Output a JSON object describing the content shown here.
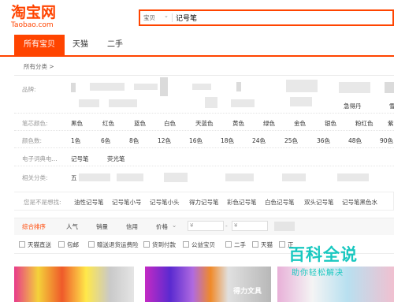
{
  "header": {
    "logo_cn": "淘宝网",
    "logo_en": "Taobao.com",
    "search_scope": "宝贝",
    "search_query": "记号笔"
  },
  "tabs": [
    "所有宝贝",
    "天猫",
    "二手"
  ],
  "breadcrumb": "所有分类 >",
  "filters": {
    "brand_label": "品牌:",
    "core_color_label": "笔芯颜色:",
    "core_colors": [
      "黑色",
      "红色",
      "蓝色",
      "白色",
      "天蓝色",
      "黄色",
      "绿色",
      "金色",
      "银色",
      "粉红色",
      "紫"
    ],
    "color_count_label": "颜色数:",
    "color_counts": [
      "1色",
      "6色",
      "8色",
      "12色",
      "16色",
      "18色",
      "24色",
      "25色",
      "36色",
      "48色",
      "90色"
    ],
    "dict_label": "电子词典电...",
    "dict_values": [
      "记号笔",
      "荧光笔"
    ],
    "related_label": "相关分类:",
    "related_first": "五",
    "brand_partial_1": "急得丹",
    "brand_partial_2": "雪"
  },
  "suggest": {
    "label": "您是不是想找:",
    "items": [
      "油性记号笔",
      "记号笔小号",
      "记号笔小头",
      "得力记号笔",
      "彩色记号笔",
      "白色记号笔",
      "双头记号笔",
      "记号笔黑色水"
    ]
  },
  "sort": {
    "items": [
      "综合排序",
      "人气",
      "销量",
      "信用",
      "价格"
    ],
    "price_from": "¥",
    "price_to": "¥"
  },
  "checks": [
    "天猫直送",
    "包邮",
    "赠送退货运费险",
    "货到付款",
    "公益宝贝",
    "二手",
    "天猫",
    "正"
  ],
  "watermark": {
    "title": "百科全说",
    "subtitle": "助你轻松解决"
  },
  "product_banner_text": "得力文具"
}
